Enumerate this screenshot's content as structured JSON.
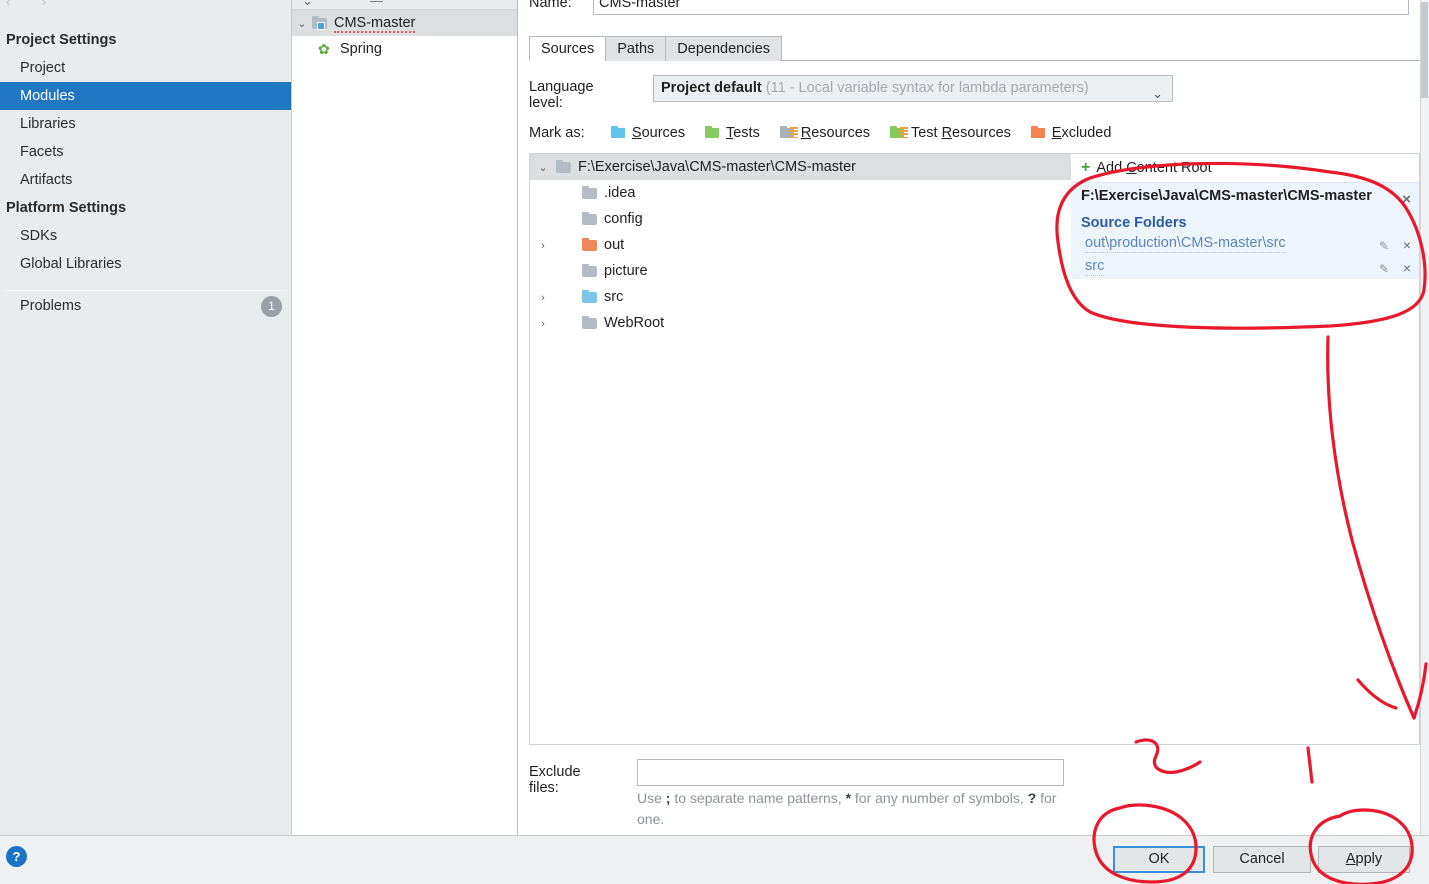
{
  "sidebar": {
    "groups": [
      {
        "title": "Project Settings",
        "items": [
          {
            "label": "Project",
            "selected": false
          },
          {
            "label": "Modules",
            "selected": true
          },
          {
            "label": "Libraries",
            "selected": false
          },
          {
            "label": "Facets",
            "selected": false
          },
          {
            "label": "Artifacts",
            "selected": false
          }
        ]
      },
      {
        "title": "Platform Settings",
        "items": [
          {
            "label": "SDKs",
            "selected": false
          },
          {
            "label": "Global Libraries",
            "selected": false
          }
        ]
      }
    ],
    "problems": {
      "label": "Problems",
      "count": "1"
    }
  },
  "module_tree": {
    "nodes": [
      {
        "label": "CMS-master",
        "icon": "module-folder-icon",
        "chevron": "⌄",
        "selected": true,
        "misspelled": true
      },
      {
        "label": "Spring",
        "icon": "spring-leaf-icon",
        "chevron": "",
        "selected": false,
        "misspelled": false
      }
    ]
  },
  "detail": {
    "name_label": "Name:",
    "name_value": "CMS-master",
    "tabs": [
      {
        "label": "Sources",
        "active": true
      },
      {
        "label": "Paths",
        "active": false
      },
      {
        "label": "Dependencies",
        "active": false
      }
    ],
    "language_level": {
      "label": "Language level:",
      "value": "Project default",
      "detail": "(11 - Local variable syntax for lambda parameters)",
      "caret": "⌄"
    },
    "mark_as": {
      "label": "Mark as:",
      "buttons": [
        {
          "pre": "",
          "mnemonic": "S",
          "post": "ources",
          "icon": "sources-folder-icon"
        },
        {
          "pre": "",
          "mnemonic": "T",
          "post": "ests",
          "icon": "tests-folder-icon"
        },
        {
          "pre": "",
          "mnemonic": "R",
          "post": "esources",
          "icon": "resources-folder-icon"
        },
        {
          "pre": "Test ",
          "mnemonic": "R",
          "post": "esources",
          "icon": "test-resources-folder-icon"
        },
        {
          "pre": "",
          "mnemonic": "E",
          "post": "xcluded",
          "icon": "excluded-folder-icon"
        }
      ]
    },
    "file_tree": [
      {
        "label": "F:\\Exercise\\Java\\CMS-master\\CMS-master",
        "indent": 0,
        "chevron": "⌄",
        "color": "gray",
        "selected": true
      },
      {
        "label": ".idea",
        "indent": 1,
        "chevron": "",
        "color": "gray",
        "selected": false
      },
      {
        "label": "config",
        "indent": 1,
        "chevron": "",
        "color": "gray",
        "selected": false
      },
      {
        "label": "out",
        "indent": 1,
        "chevron": "›",
        "color": "orange",
        "selected": false
      },
      {
        "label": "picture",
        "indent": 1,
        "chevron": "",
        "color": "gray",
        "selected": false
      },
      {
        "label": "src",
        "indent": 1,
        "chevron": "›",
        "color": "blue",
        "selected": false
      },
      {
        "label": "WebRoot",
        "indent": 1,
        "chevron": "›",
        "color": "gray",
        "selected": false
      }
    ],
    "content_roots": {
      "add_label_pre": "Add ",
      "add_mnemonic": "C",
      "add_label_post": "ontent Root",
      "plus": "+",
      "root_path": "F:\\Exercise\\Java\\CMS-master\\CMS-master",
      "source_folders_title": "Source Folders",
      "source_folders": [
        {
          "path": "out\\production\\CMS-master\\src"
        },
        {
          "path": "src"
        }
      ],
      "close_glyph": "×",
      "pencil_glyph": "✎"
    },
    "exclude": {
      "label": "Exclude files:",
      "value": "",
      "hint_1": "Use ",
      "hint_semicolon": ";",
      "hint_2": " to separate name patterns, ",
      "hint_star": "*",
      "hint_3": " for any number of symbols, ",
      "hint_question": "?",
      "hint_4": " for one."
    }
  },
  "bottom": {
    "help": "?",
    "ok": "OK",
    "cancel": "Cancel",
    "apply_pre": "",
    "apply_mnemonic": "A",
    "apply_post": "pply"
  },
  "colors": {
    "selection_blue": "#2176c1",
    "annotation_red": "#e8192c",
    "focus_blue": "#3a8fd8",
    "link_blue": "#5b87b8",
    "header_blue": "#2a5d9f"
  }
}
